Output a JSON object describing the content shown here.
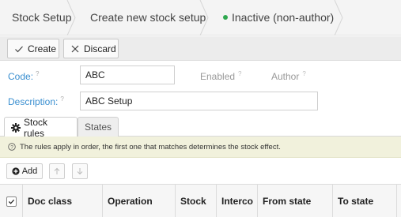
{
  "breadcrumb": {
    "items": [
      "Stock Setup",
      "Create new stock setup"
    ],
    "status": "Inactive (non-author)",
    "status_color": "#2fa84f"
  },
  "toolbar": {
    "create_label": "Create",
    "discard_label": "Discard"
  },
  "form": {
    "code_label": "Code:",
    "code_value": "ABC",
    "enabled_label": "Enabled",
    "author_label": "Author",
    "description_label": "Description:",
    "description_value": "ABC Setup",
    "help_mark": "?"
  },
  "tabs": [
    {
      "label": "Stock rules",
      "icon": "gear-icon",
      "active": true
    },
    {
      "label": "States",
      "active": false
    }
  ],
  "info": {
    "text": "The rules apply in order, the first one that matches determines the stock effect.",
    "icon": "question-circle-icon"
  },
  "rules_toolbar": {
    "add_label": "Add",
    "up_icon": "arrow-up-icon",
    "down_icon": "arrow-down-icon"
  },
  "table": {
    "columns": [
      "Doc class",
      "Operation",
      "Stock",
      "Interco",
      "From state",
      "To state"
    ]
  },
  "colors": {
    "accent": "#3a8fd0",
    "info_bg": "#f1f1dc"
  }
}
